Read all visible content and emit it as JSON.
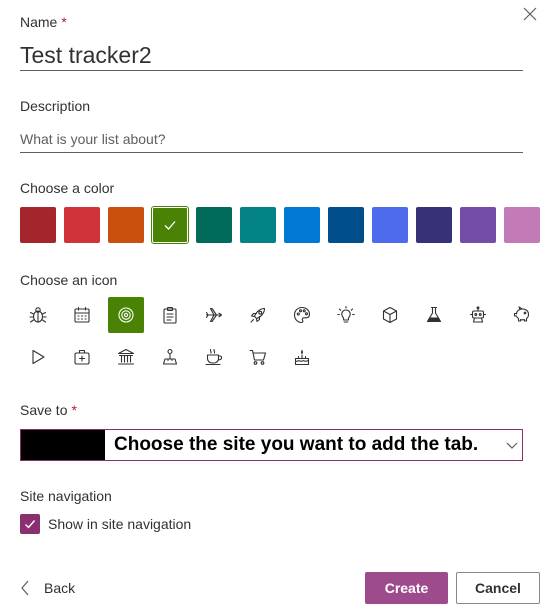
{
  "name_field": {
    "label": "Name",
    "required_marker": "*",
    "value": "Test tracker2"
  },
  "description_field": {
    "label": "Description",
    "placeholder": "What is your list about?"
  },
  "color_picker": {
    "label": "Choose a color",
    "colors": [
      "#a4262c",
      "#d13438",
      "#ca5010",
      "#498205",
      "#006b5a",
      "#038387",
      "#0078d4",
      "#004e8c",
      "#4f6bed",
      "#373277",
      "#744da9",
      "#c27bb6"
    ],
    "selected_color": "#498205"
  },
  "icon_picker": {
    "label": "Choose an icon",
    "icons": [
      "bug-icon",
      "calendar-icon",
      "target-icon",
      "clipboard-icon",
      "airplane-icon",
      "rocket-icon",
      "palette-icon",
      "lightbulb-icon",
      "cube-icon",
      "flask-icon",
      "robot-icon",
      "piggy-bank-icon",
      "play-icon",
      "first-aid-icon",
      "bank-icon",
      "joystick-icon",
      "coffee-cup-icon",
      "shopping-cart-icon",
      "cake-icon"
    ],
    "selected_icon": "target-icon"
  },
  "save_to": {
    "label": "Save to",
    "required_marker": "*",
    "value": "Choose the site you want to add the tab."
  },
  "site_navigation": {
    "label": "Site navigation",
    "checkbox_label": "Show in site navigation",
    "checked": true
  },
  "footer": {
    "back_label": "Back",
    "create_label": "Create",
    "cancel_label": "Cancel"
  }
}
